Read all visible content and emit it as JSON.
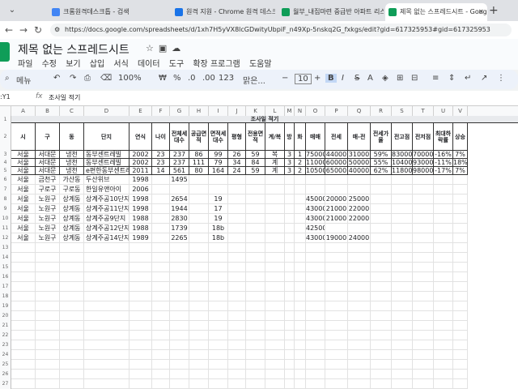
{
  "browser": {
    "tabs": [
      {
        "label": "크롬원격데스크톱 - 검색",
        "color": "#4285f4"
      },
      {
        "label": "원격 지원 - Chrome 원격 데스크톱",
        "color": "#1a73e8"
      },
      {
        "label": "월부_내집마련 중급반 아파트 리스",
        "color": "#0f9d58"
      },
      {
        "label": "제목 없는 스프레드시트 - Google",
        "color": "#0f9d58"
      }
    ],
    "url": "https://docs.google.com/spreadsheets/d/1xh7H5yVX8lcGDwityUbpiF_n49Xp-5nskq2G_fxkgs/edit?gid=617325953#gid=617325953"
  },
  "app": {
    "title": "제목 없는 스프레드시트",
    "menu": [
      "파일",
      "수정",
      "보기",
      "삽입",
      "서식",
      "데이터",
      "도구",
      "확장 프로그램",
      "도움말"
    ]
  },
  "toolbar": {
    "menu_search": "메뉴",
    "zoom": "100%",
    "currency": "₩",
    "percent": "%",
    "dec_less": ".0",
    "dec_more": ".00",
    "num_format": "123",
    "font": "맑은...",
    "font_size": "10"
  },
  "formula": {
    "cell_ref": ":Y1",
    "fx": "fx",
    "value": "조사일 적기"
  },
  "sheet": {
    "columns": [
      "A",
      "B",
      "C",
      "D",
      "E",
      "F",
      "G",
      "H",
      "I",
      "J",
      "K",
      "L",
      "M",
      "N",
      "O",
      "P",
      "Q",
      "R",
      "S",
      "T",
      "U",
      "V"
    ],
    "banner": "조사일 적기",
    "header": [
      "시",
      "구",
      "동",
      "단지",
      "연식",
      "나이",
      "전체세대수",
      "공급면적",
      "면적세대수",
      "평형",
      "전용면적",
      "계/복",
      "방",
      "화",
      "매매",
      "전세",
      "매-전",
      "전세가율",
      "전고점",
      "전저점",
      "최대하락률",
      "상승"
    ],
    "rows": [
      [
        "서울",
        "서대문",
        "냉천",
        "동부센트레빌",
        "2002",
        "23",
        "237",
        "86",
        "99",
        "26",
        "59",
        "복",
        "3",
        "1",
        "75000",
        "44000",
        "31000",
        "59%",
        "83000",
        "70000",
        "-16%",
        "7%"
      ],
      [
        "서울",
        "서대문",
        "냉천",
        "동부센트레빌",
        "2002",
        "23",
        "237",
        "111",
        "79",
        "34",
        "84",
        "계",
        "3",
        "2",
        "110000",
        "60000",
        "50000",
        "55%",
        "104000",
        "93000",
        "-11%",
        "18%"
      ],
      [
        "서울",
        "서대문",
        "냉천",
        "e편한동부센트레빌",
        "2011",
        "14",
        "561",
        "80",
        "164",
        "24",
        "59",
        "계",
        "3",
        "2",
        "105000",
        "65000",
        "40000",
        "62%",
        "118000",
        "98000",
        "-17%",
        "7%"
      ]
    ],
    "plain_rows": [
      [
        "서울",
        "금천구",
        "가산동",
        "두산위브",
        "1998",
        "",
        "1495"
      ],
      [
        "서울",
        "구로구",
        "구로동",
        "한일유앤아이",
        "2006"
      ],
      [
        "서울",
        "노원구",
        "상계동",
        "상계주공10단지",
        "1998",
        "",
        "2654",
        "",
        "19",
        "",
        "",
        "",
        "",
        "",
        "45000",
        "20000",
        "25000"
      ],
      [
        "서울",
        "노원구",
        "상계동",
        "상계주공11단지",
        "1998",
        "",
        "1944",
        "",
        "17",
        "",
        "",
        "",
        "",
        "",
        "43000",
        "21000",
        "22000"
      ],
      [
        "서울",
        "노원구",
        "상계동",
        "상계주공9단지",
        "1988",
        "",
        "2830",
        "",
        "19",
        "",
        "",
        "",
        "",
        "",
        "43000",
        "21000",
        "22000"
      ],
      [
        "서울",
        "노원구",
        "상계동",
        "상계주공12단지",
        "1988",
        "",
        "1739",
        "",
        "18b",
        "",
        "",
        "",
        "",
        "",
        "42500"
      ],
      [
        "서울",
        "노원구",
        "상계동",
        "상계주공14단지",
        "1989",
        "",
        "2265",
        "",
        "18b",
        "",
        "",
        "",
        "",
        "",
        "43000",
        "19000",
        "24000"
      ]
    ]
  }
}
